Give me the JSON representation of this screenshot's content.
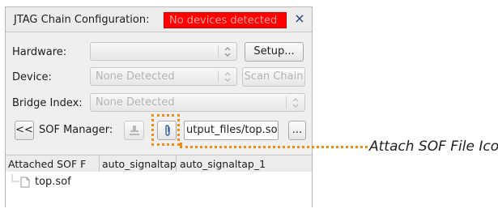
{
  "window": {
    "title": "JTAG Chain Configuration:",
    "status_badge": "No devices detected",
    "close_label": "×"
  },
  "hardware": {
    "label": "Hardware:",
    "value": "",
    "setup_button": "Setup..."
  },
  "device": {
    "label": "Device:",
    "value": "None Detected",
    "scan_chain_button": "Scan Chain"
  },
  "bridge_index": {
    "label": "Bridge Index:",
    "value": "None Detected"
  },
  "sof_manager": {
    "collapse_button": "<<",
    "label": "SOF Manager:",
    "program_icon": "program-device-icon",
    "attach_icon": "attach-file-icon",
    "file_path": "utput_files/top.sof",
    "browse_button": "..."
  },
  "table": {
    "columns": [
      "Attached SOF F",
      "auto_signaltap",
      "auto_signaltap_1"
    ],
    "tree_item": "top.sof"
  },
  "annotation": {
    "label": "Attach SOF File Icon",
    "color": "#f28c13"
  },
  "colors": {
    "status_red": "#ff0000",
    "panel_bg": "#efefef"
  }
}
